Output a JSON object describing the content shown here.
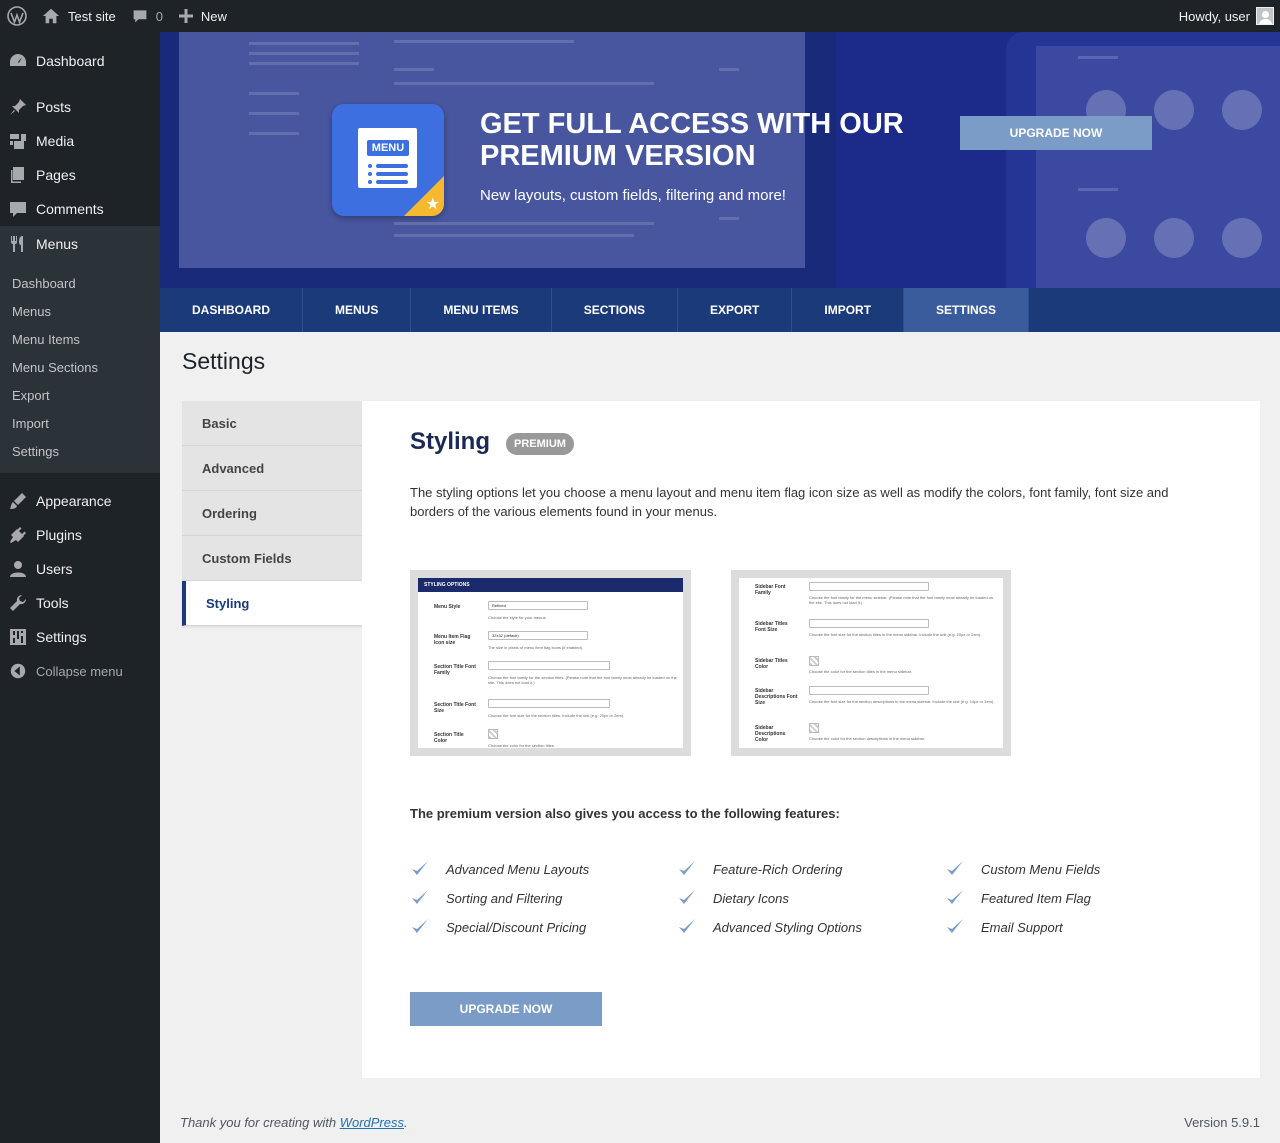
{
  "adminbar": {
    "site_name": "Test site",
    "comment_count": "0",
    "new_label": "New",
    "howdy": "Howdy, user"
  },
  "sidebar": {
    "items": [
      {
        "label": "Dashboard",
        "icon": "dashboard-icon"
      },
      {
        "label": "Posts",
        "icon": "pin-icon"
      },
      {
        "label": "Media",
        "icon": "media-icon"
      },
      {
        "label": "Pages",
        "icon": "pages-icon"
      },
      {
        "label": "Comments",
        "icon": "comments-icon"
      },
      {
        "label": "Menus",
        "icon": "utensils-icon"
      }
    ],
    "submenu": [
      "Dashboard",
      "Menus",
      "Menu Items",
      "Menu Sections",
      "Export",
      "Import",
      "Settings"
    ],
    "items_bottom": [
      {
        "label": "Appearance",
        "icon": "brush-icon"
      },
      {
        "label": "Plugins",
        "icon": "plug-icon"
      },
      {
        "label": "Users",
        "icon": "user-icon"
      },
      {
        "label": "Tools",
        "icon": "wrench-icon"
      },
      {
        "label": "Settings",
        "icon": "sliders-icon"
      }
    ],
    "collapse_label": "Collapse menu"
  },
  "banner": {
    "badge_label": "MENU",
    "title": "GET FULL ACCESS WITH OUR PREMIUM VERSION",
    "subtitle": "New layouts, custom fields, filtering and more!",
    "button": "UPGRADE NOW"
  },
  "nav": {
    "tabs": [
      "DASHBOARD",
      "MENUS",
      "MENU ITEMS",
      "SECTIONS",
      "EXPORT",
      "IMPORT",
      "SETTINGS"
    ],
    "active": "SETTINGS"
  },
  "page": {
    "title": "Settings"
  },
  "settings_tabs": [
    "Basic",
    "Advanced",
    "Ordering",
    "Custom Fields",
    "Styling"
  ],
  "panel": {
    "title": "Styling",
    "badge": "PREMIUM",
    "description": "The styling options let you choose a menu layout and menu item flag icon size as well as modify the colors, font family, font size and borders of the various elements found in your menus.",
    "shot1": {
      "header": "STYLING OPTIONS",
      "fields": [
        {
          "label": "Menu Style",
          "value": "Refined",
          "help": "Choose the style for your menus."
        },
        {
          "label": "Menu Item Flag Icon size",
          "value": "32x32 (default)",
          "help": "The size in pixels of menu item flag icons (if enabled)."
        },
        {
          "label": "Section Title Font Family",
          "value": "",
          "help": "Choose the font family for the section titles. (Please note that the font family must already be loaded on the site. This does not load it.)"
        },
        {
          "label": "Section Title Font Size",
          "value": "",
          "help": "Choose the font size for the section titles. Include the unit (e.g. 20px or 2em)."
        },
        {
          "label": "Section Title Color",
          "value": "",
          "help": "Choose the color for the section titles."
        }
      ]
    },
    "shot2": {
      "fields": [
        {
          "label": "Sidebar Font Family",
          "help": "Choose the font family for the menu sidebar. (Please note that the font family must already be loaded on the site. This does not load it.)"
        },
        {
          "label": "Sidebar Titles Font Size",
          "help": "Choose the font size for the section titles in the menu sidebar. Include the unit (e.g. 20px or 2em)."
        },
        {
          "label": "Sidebar Titles Color",
          "help": "Choose the color for the section titles in the menu sidebar."
        },
        {
          "label": "Sidebar Descriptions Font Size",
          "help": "Choose the font size for the section descriptions in the menu sidebar. Include the unit (e.g. 14px or 1em)."
        },
        {
          "label": "Sidebar Descriptions Color",
          "help": "Choose the color for the section descriptions in the menu sidebar."
        }
      ]
    },
    "features_lead": "The premium version also gives you access to the following features:",
    "features": [
      "Advanced Menu Layouts",
      "Feature-Rich Ordering",
      "Custom Menu Fields",
      "Sorting and Filtering",
      "Dietary Icons",
      "Featured Item Flag",
      "Special/Discount Pricing",
      "Advanced Styling Options",
      "Email Support"
    ],
    "button": "UPGRADE NOW"
  },
  "footer": {
    "thanks_prefix": "Thank you for creating with ",
    "link": "WordPress",
    "thanks_suffix": ".",
    "version": "Version 5.9.1"
  },
  "colors": {
    "adminbar": "#1d2327",
    "banner_bg": "#1a2a7a",
    "nav_bg": "#1a3a7a",
    "nav_active": "#3a5c9c",
    "upgrade_button": "#7a9cc6",
    "check": "#7a9cc6"
  }
}
